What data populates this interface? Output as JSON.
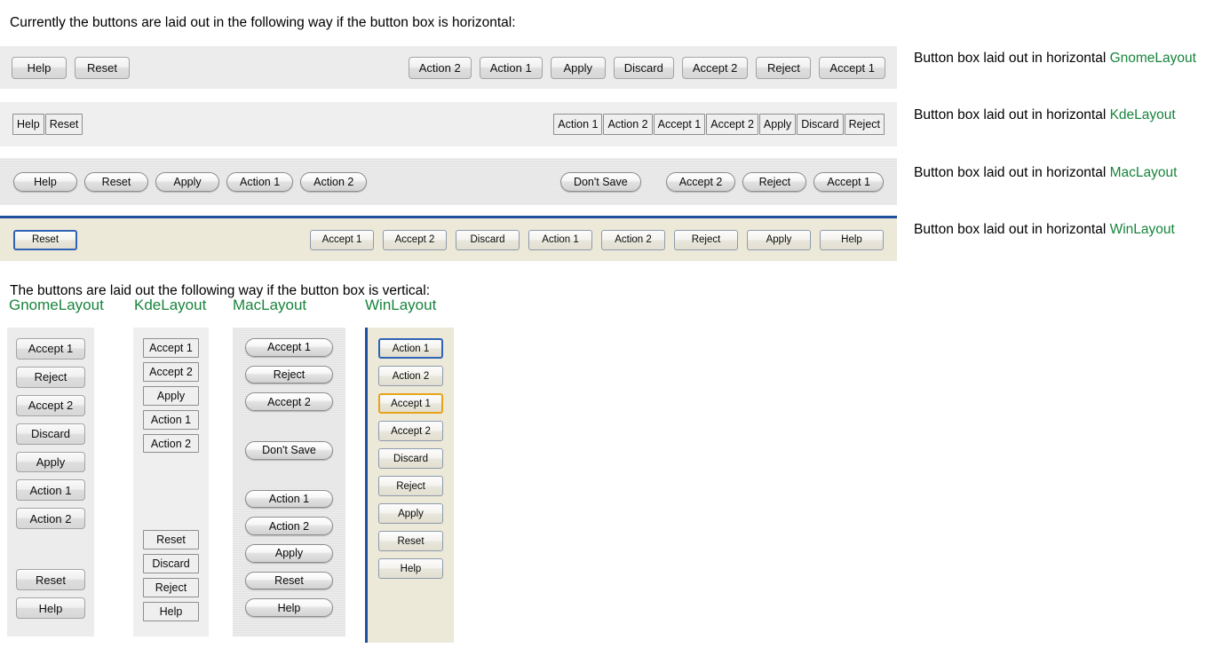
{
  "page": {
    "horizontal_intro": "Currently the buttons are laid out in the following way if the button box is horizontal:",
    "vertical_intro": "The buttons are laid out the following way if the button box is vertical:",
    "caption_prefix": "Button box laid out in horizontal ",
    "accent_green": "#18843c",
    "win_default_border": "#2f63b5",
    "win_focus_border": "#e8a21c"
  },
  "horizontal": [
    {
      "style": "gnome",
      "layout_name": "GnomeLayout",
      "caption": "Button box laid out in horizontal ",
      "left_buttons": [
        "Help",
        "Reset"
      ],
      "right_buttons": [
        "Action 2",
        "Action 1",
        "Apply",
        "Discard",
        "Accept 2",
        "Reject",
        "Accept 1"
      ]
    },
    {
      "style": "kde",
      "layout_name": "KdeLayout",
      "caption": "Button box laid out in horizontal ",
      "left_buttons": [
        "Help",
        "Reset"
      ],
      "right_buttons": [
        "Action 1",
        "Action 2",
        "Accept 1",
        "Accept 2",
        "Apply",
        "Discard",
        "Reject"
      ]
    },
    {
      "style": "mac",
      "layout_name": "MacLayout",
      "caption": "Button box laid out in horizontal ",
      "left_buttons": [
        "Help",
        "Reset",
        "Apply",
        "Action 1",
        "Action 2"
      ],
      "right_buttons": [
        "Don't Save",
        "Accept 2",
        "Reject",
        "Accept 1"
      ]
    },
    {
      "style": "win",
      "layout_name": "WinLayout",
      "caption": "Button box laid out in horizontal ",
      "left_buttons": [
        "Reset"
      ],
      "left_button_states": [
        "default"
      ],
      "right_buttons": [
        "Accept 1",
        "Accept 2",
        "Discard",
        "Action 1",
        "Action 2",
        "Reject",
        "Apply",
        "Help"
      ]
    }
  ],
  "vertical": [
    {
      "style": "gnome",
      "heading": "GnomeLayout",
      "items": [
        {
          "label": "Accept 1"
        },
        {
          "label": "Reject"
        },
        {
          "label": "Accept 2"
        },
        {
          "label": "Discard"
        },
        {
          "label": "Apply"
        },
        {
          "label": "Action 1"
        },
        {
          "label": "Action 2"
        },
        {
          "gap": 37
        },
        {
          "label": "Reset"
        },
        {
          "label": "Help"
        }
      ]
    },
    {
      "style": "kde",
      "heading": "KdeLayout",
      "items": [
        {
          "label": "Accept 1"
        },
        {
          "label": "Accept 2"
        },
        {
          "label": "Apply"
        },
        {
          "label": "Action 1"
        },
        {
          "label": "Action 2"
        },
        {
          "gap": 82
        },
        {
          "label": "Reset"
        },
        {
          "label": "Discard"
        },
        {
          "label": "Reject"
        },
        {
          "label": "Help"
        }
      ]
    },
    {
      "style": "mac",
      "heading": "MacLayout",
      "items": [
        {
          "label": "Accept 1"
        },
        {
          "label": "Reject"
        },
        {
          "label": "Accept 2"
        },
        {
          "gap": 24
        },
        {
          "label": "Don't Save"
        },
        {
          "gap": 24
        },
        {
          "label": "Action 1"
        },
        {
          "label": "Action 2"
        },
        {
          "label": "Apply"
        },
        {
          "label": "Reset"
        },
        {
          "label": "Help"
        }
      ]
    },
    {
      "style": "win",
      "heading": "WinLayout",
      "items": [
        {
          "label": "Action 1",
          "state": "default"
        },
        {
          "label": "Action 2"
        },
        {
          "label": "Accept 1",
          "state": "focus"
        },
        {
          "label": "Accept 2"
        },
        {
          "label": "Discard"
        },
        {
          "label": "Reject"
        },
        {
          "label": "Apply"
        },
        {
          "label": "Reset"
        },
        {
          "label": "Help"
        }
      ]
    }
  ]
}
